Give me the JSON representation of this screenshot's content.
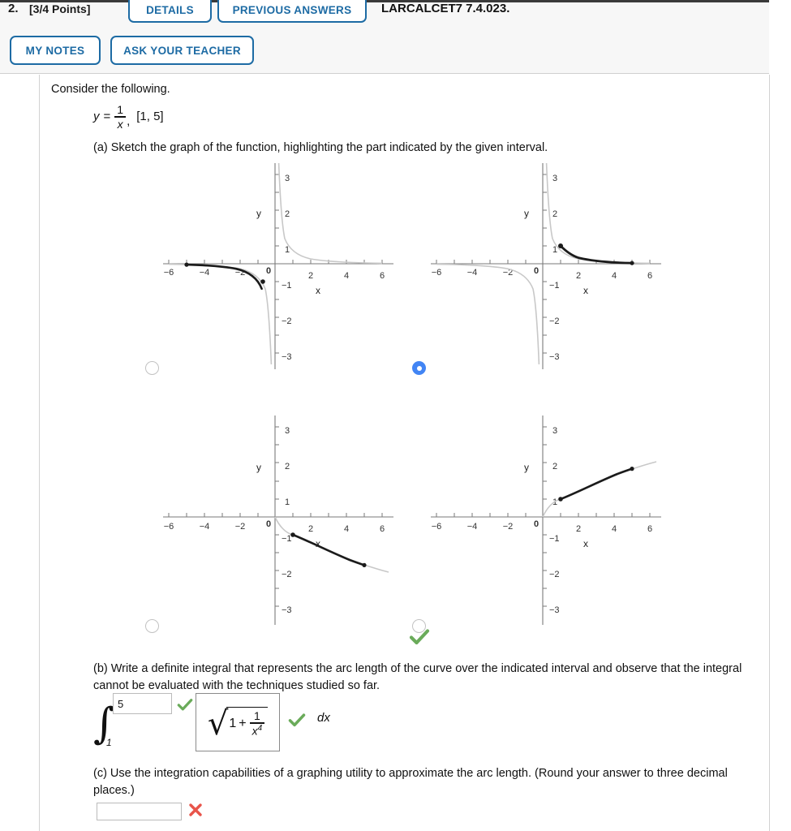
{
  "header": {
    "question_number": "2.",
    "points_label": "[3/4 Points]",
    "details_label": "DETAILS",
    "previous_answers_label": "PREVIOUS ANSWERS",
    "assignment_code": "LARCALCET7 7.4.023.",
    "my_notes_label": "MY NOTES",
    "ask_teacher_label": "ASK YOUR TEACHER",
    "accent_blue": "#1d6ba4"
  },
  "question": {
    "intro": "Consider the following.",
    "equation": {
      "lhs": "y",
      "equals": "=",
      "numerator": "1",
      "denominator": "x",
      "comma": ",",
      "interval": "[1, 5]"
    },
    "part_a": "(a) Sketch the graph of the function, highlighting the part indicated by the given interval.",
    "part_b": "(b) Write a definite integral that represents the arc length of the curve over the indicated interval and observe that the integral cannot be evaluated with the techniques studied so far.",
    "part_c": "(c) Use the integration capabilities of a graphing utility to approximate the arc length. (Round your answer to three decimal places.)"
  },
  "answer_b": {
    "lower_limit": "1",
    "upper_limit_value": "5",
    "upper_limit_placeholder": "",
    "integrand_one": "1",
    "integrand_plus": "+",
    "integrand_frac_num": "1",
    "integrand_frac_den": "x",
    "integrand_frac_den_exp": "4",
    "differential": "dx",
    "limit_status": "correct",
    "integrand_status": "correct",
    "correct_color": "#6aab5a"
  },
  "answer_c": {
    "value": "",
    "placeholder": "",
    "status": "incorrect",
    "incorrect_color": "#e8544a"
  },
  "options": {
    "selected_index": 1,
    "graded_index": 3,
    "graded_status": "correct",
    "selected_color": "#4285f4",
    "items": [
      {
        "name": "graph-option-a",
        "selected": false
      },
      {
        "name": "graph-option-b",
        "selected": true
      },
      {
        "name": "graph-option-c",
        "selected": false
      },
      {
        "name": "graph-option-d",
        "selected": false
      }
    ]
  },
  "chart_data": [
    {
      "id": "graph-option-a",
      "type": "line",
      "title": "",
      "xlabel": "x",
      "ylabel": "y",
      "xlim": [
        -6,
        6
      ],
      "ylim": [
        -3,
        3
      ],
      "xticks": [
        -6,
        -4,
        -2,
        0,
        2,
        4,
        6
      ],
      "yticks": [
        -3,
        -2,
        -1,
        0,
        1,
        2,
        3
      ],
      "grid": false,
      "legend": "none",
      "series": [
        {
          "name": "y = 1/x (full curve)",
          "style": "light-gray",
          "function": "1/x"
        },
        {
          "name": "highlighted interval [-5, -1]",
          "style": "black-bold",
          "x_range": [
            -5,
            -1
          ],
          "endpoints": [
            [
              -5,
              -0.2
            ],
            [
              -1,
              -1
            ]
          ]
        }
      ]
    },
    {
      "id": "graph-option-b",
      "type": "line",
      "title": "",
      "xlabel": "x",
      "ylabel": "y",
      "xlim": [
        -6,
        6
      ],
      "ylim": [
        -3,
        3
      ],
      "xticks": [
        -6,
        -4,
        -2,
        0,
        2,
        4,
        6
      ],
      "yticks": [
        -3,
        -2,
        -1,
        0,
        1,
        2,
        3
      ],
      "grid": false,
      "legend": "none",
      "series": [
        {
          "name": "y = 1/x (full curve)",
          "style": "light-gray",
          "function": "1/x"
        },
        {
          "name": "highlighted interval [1, 5]",
          "style": "black-bold",
          "x_range": [
            1,
            5
          ],
          "endpoints": [
            [
              1,
              1
            ],
            [
              5,
              0.2
            ]
          ]
        }
      ]
    },
    {
      "id": "graph-option-c",
      "type": "line",
      "title": "",
      "xlabel": "x",
      "ylabel": "y",
      "xlim": [
        -6,
        6
      ],
      "ylim": [
        -3,
        3
      ],
      "xticks": [
        -6,
        -4,
        -2,
        0,
        2,
        4,
        6
      ],
      "yticks": [
        -3,
        -2,
        -1,
        0,
        1,
        2,
        3
      ],
      "grid": false,
      "legend": "none",
      "series": [
        {
          "name": "y = -x^(1/2) type decreasing curve (full)",
          "style": "light-gray",
          "function": "-sqrt(x)"
        },
        {
          "name": "highlighted interval [1, 5]",
          "style": "black-bold",
          "x_range": [
            1,
            5
          ],
          "endpoints": [
            [
              1,
              -1
            ],
            [
              5,
              -2.24
            ]
          ]
        }
      ]
    },
    {
      "id": "graph-option-d",
      "type": "line",
      "title": "",
      "xlabel": "x",
      "ylabel": "y",
      "xlim": [
        -6,
        6
      ],
      "ylim": [
        -3,
        3
      ],
      "xticks": [
        -6,
        -4,
        -2,
        0,
        2,
        4,
        6
      ],
      "yticks": [
        -3,
        -2,
        -1,
        0,
        1,
        2,
        3
      ],
      "grid": false,
      "legend": "none",
      "series": [
        {
          "name": "y = x^(1/2) type increasing curve (full)",
          "style": "light-gray",
          "function": "sqrt(x)"
        },
        {
          "name": "highlighted interval [1, 5]",
          "style": "black-bold",
          "x_range": [
            1,
            5
          ],
          "endpoints": [
            [
              1,
              1
            ],
            [
              5,
              2.24
            ]
          ]
        }
      ]
    }
  ]
}
